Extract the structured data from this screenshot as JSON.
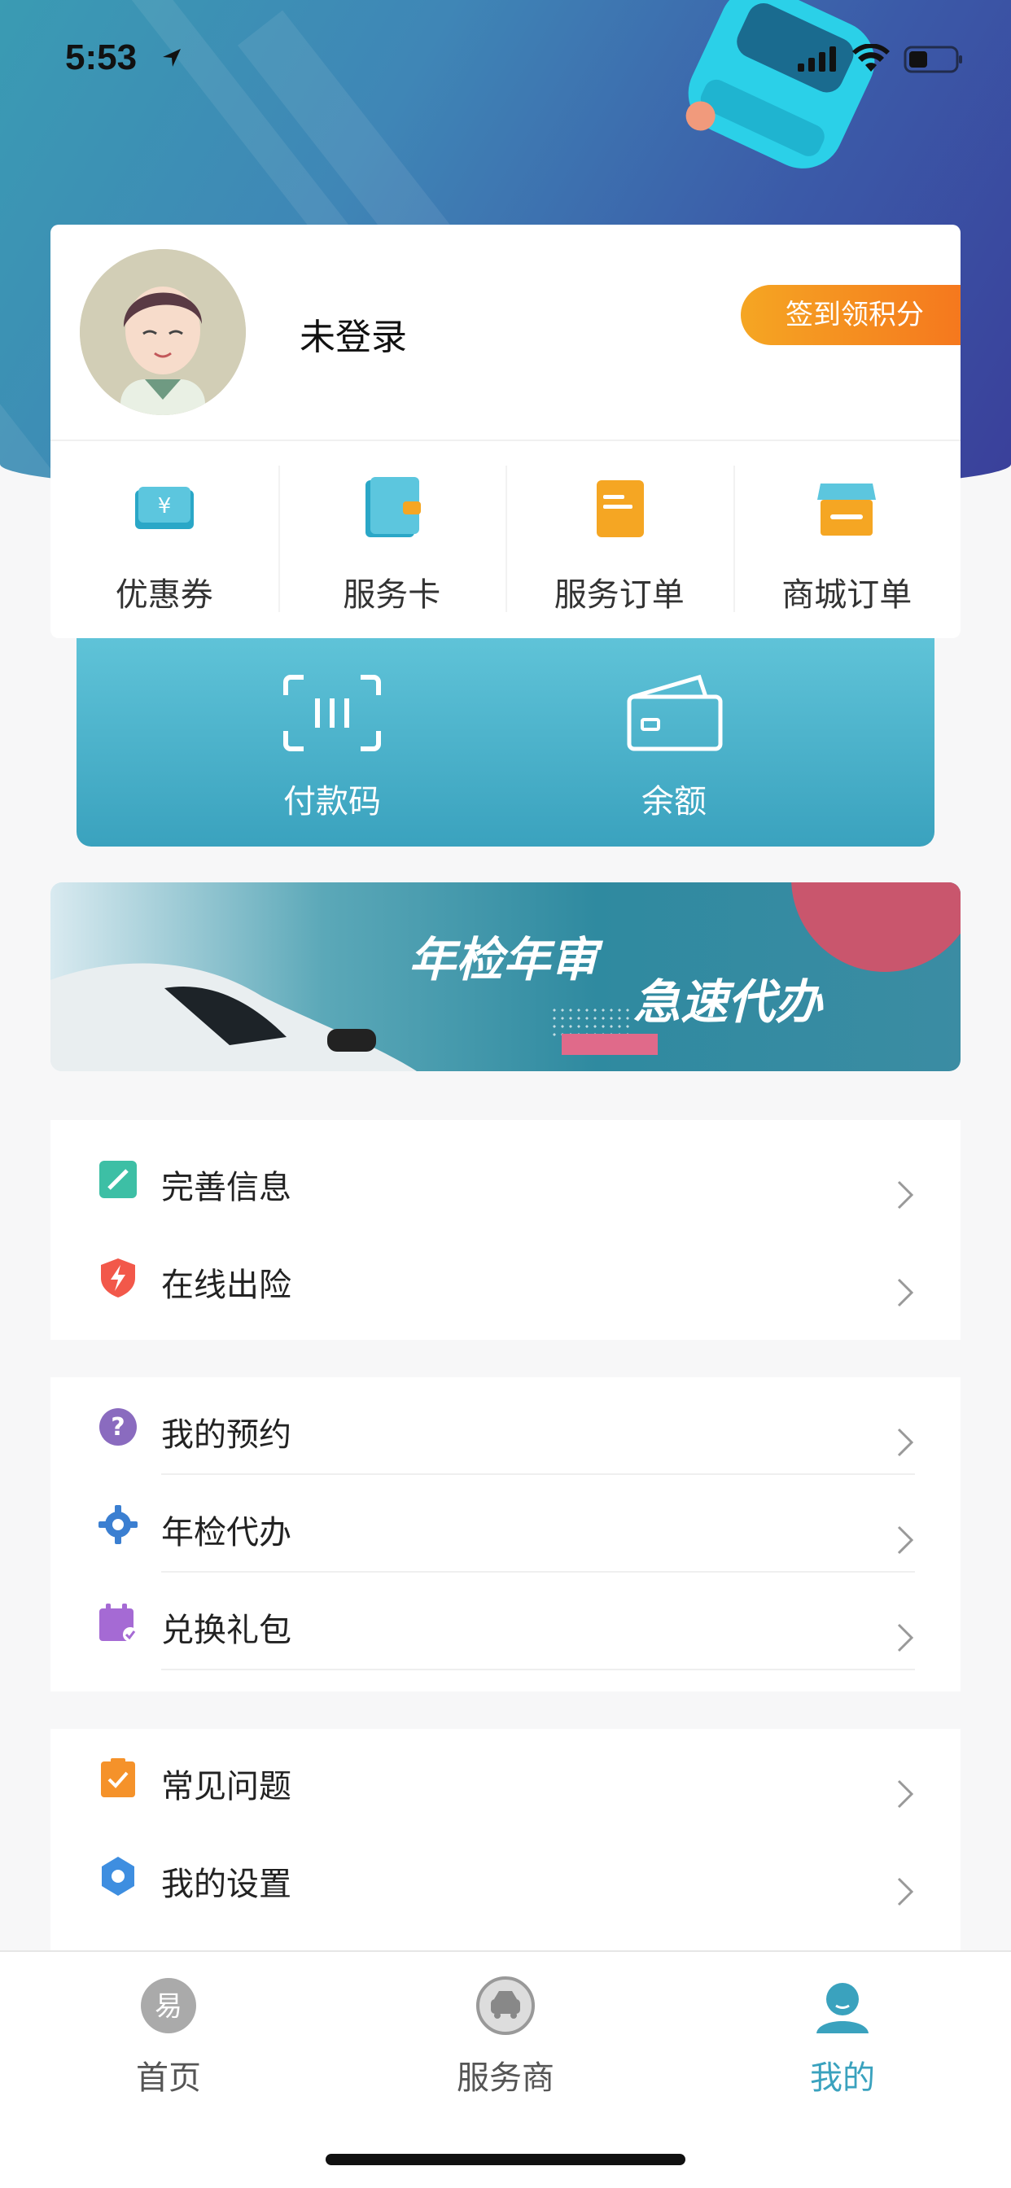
{
  "status_bar": {
    "time": "5:53"
  },
  "profile": {
    "login_text": "未登录",
    "sign_in_button": "签到领积分",
    "quick_actions": [
      {
        "label": "优惠券",
        "icon": "coupon-icon"
      },
      {
        "label": "服务卡",
        "icon": "wallet-card-icon"
      },
      {
        "label": "服务订单",
        "icon": "service-order-icon"
      },
      {
        "label": "商城订单",
        "icon": "mall-order-icon"
      }
    ]
  },
  "payment": {
    "pay_code": "付款码",
    "balance": "余额"
  },
  "banner": {
    "text1": "年检年审",
    "text2": "急速代办"
  },
  "menu_groups": [
    [
      {
        "label": "完善信息",
        "icon": "edit-info-icon"
      },
      {
        "label": "在线出险",
        "icon": "shield-bolt-icon"
      }
    ],
    [
      {
        "label": "我的预约",
        "icon": "question-icon"
      },
      {
        "label": "年检代办",
        "icon": "gear-icon"
      },
      {
        "label": "兑换礼包",
        "icon": "gift-calendar-icon"
      }
    ],
    [
      {
        "label": "常见问题",
        "icon": "clipboard-check-icon"
      },
      {
        "label": "我的设置",
        "icon": "settings-icon"
      }
    ]
  ],
  "tabbar": {
    "tabs": [
      {
        "label": "首页",
        "icon": "home-icon"
      },
      {
        "label": "服务商",
        "icon": "car-service-icon"
      },
      {
        "label": "我的",
        "icon": "profile-icon",
        "active": true
      }
    ]
  },
  "colors": {
    "accent": "#3aa2be",
    "sign_btn": "#f5781e"
  }
}
